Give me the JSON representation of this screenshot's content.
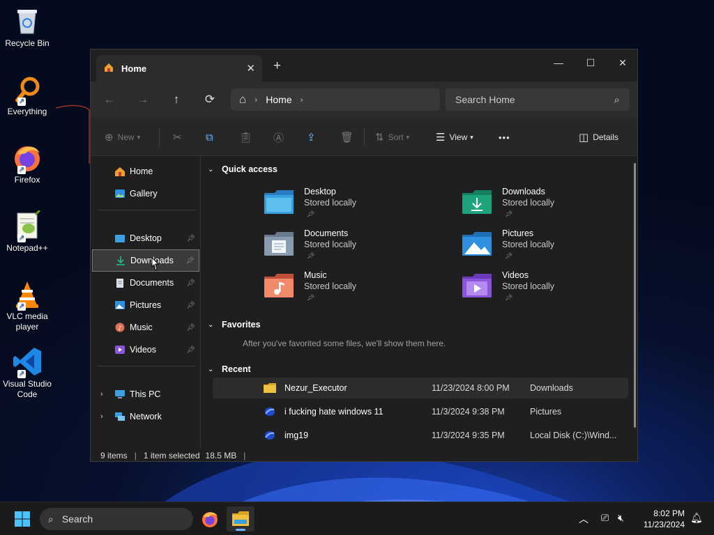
{
  "desktop": {
    "icons": [
      {
        "label": "Recycle Bin"
      },
      {
        "label": "Everything"
      },
      {
        "label": "Firefox"
      },
      {
        "label": "Notepad++"
      },
      {
        "label": "VLC media player"
      },
      {
        "label": "Visual Studio Code"
      }
    ]
  },
  "window": {
    "tab": {
      "title": "Home",
      "close": "✕"
    },
    "new_tab": "+",
    "controls": {
      "minimize": "—",
      "maximize": "☐",
      "close": "✕"
    },
    "nav": {
      "back": "←",
      "forward": "→",
      "up": "↑",
      "refresh": "⟳"
    },
    "address": {
      "home_glyph": "⌂",
      "crumb": "Home",
      "sep": "›"
    },
    "search": {
      "placeholder": "Search Home",
      "icon": "⌕"
    },
    "commands": {
      "new": "New",
      "sort": "Sort",
      "view": "View",
      "more": "•••",
      "details": "Details"
    },
    "sidebar": {
      "top": [
        {
          "label": "Home",
          "icon": "home-icon"
        },
        {
          "label": "Gallery",
          "icon": "gallery-icon"
        }
      ],
      "pinned": [
        {
          "label": "Desktop",
          "icon": "desktop-folder-icon"
        },
        {
          "label": "Downloads",
          "icon": "downloads-folder-icon"
        },
        {
          "label": "Documents",
          "icon": "documents-folder-icon"
        },
        {
          "label": "Pictures",
          "icon": "pictures-folder-icon"
        },
        {
          "label": "Music",
          "icon": "music-folder-icon"
        },
        {
          "label": "Videos",
          "icon": "videos-folder-icon"
        }
      ],
      "bottom": [
        {
          "label": "This PC",
          "icon": "this-pc-icon"
        },
        {
          "label": "Network",
          "icon": "network-icon"
        }
      ],
      "selected": "Downloads"
    },
    "quick_access": {
      "header": "Quick access",
      "items": [
        {
          "name": "Desktop",
          "status": "Stored locally",
          "color": "#3aa0e0"
        },
        {
          "name": "Downloads",
          "status": "Stored locally",
          "color": "#1fa37c"
        },
        {
          "name": "Documents",
          "status": "Stored locally",
          "color": "#8a9bb0"
        },
        {
          "name": "Pictures",
          "status": "Stored locally",
          "color": "#2f8fe0"
        },
        {
          "name": "Music",
          "status": "Stored locally",
          "color": "#e0705a"
        },
        {
          "name": "Videos",
          "status": "Stored locally",
          "color": "#8a55d8"
        }
      ]
    },
    "favorites": {
      "header": "Favorites",
      "note": "After you've favorited some files, we'll show them here."
    },
    "recent": {
      "header": "Recent",
      "rows": [
        {
          "name": "Nezur_Executor",
          "date": "11/23/2024 8:00 PM",
          "location": "Downloads"
        },
        {
          "name": "i fucking hate windows 11",
          "date": "11/3/2024 9:38 PM",
          "location": "Pictures"
        },
        {
          "name": "img19",
          "date": "11/3/2024 9:35 PM",
          "location": "Local Disk (C:)\\Wind..."
        }
      ]
    },
    "status": {
      "items": "9 items",
      "selected": "1 item selected",
      "size": "18.5 MB"
    }
  },
  "taskbar": {
    "search_label": "Search",
    "time": "8:02 PM",
    "date": "11/23/2024"
  },
  "colors": {
    "accent": "#6cb6ff",
    "folder_yellow": "#f0c040"
  }
}
